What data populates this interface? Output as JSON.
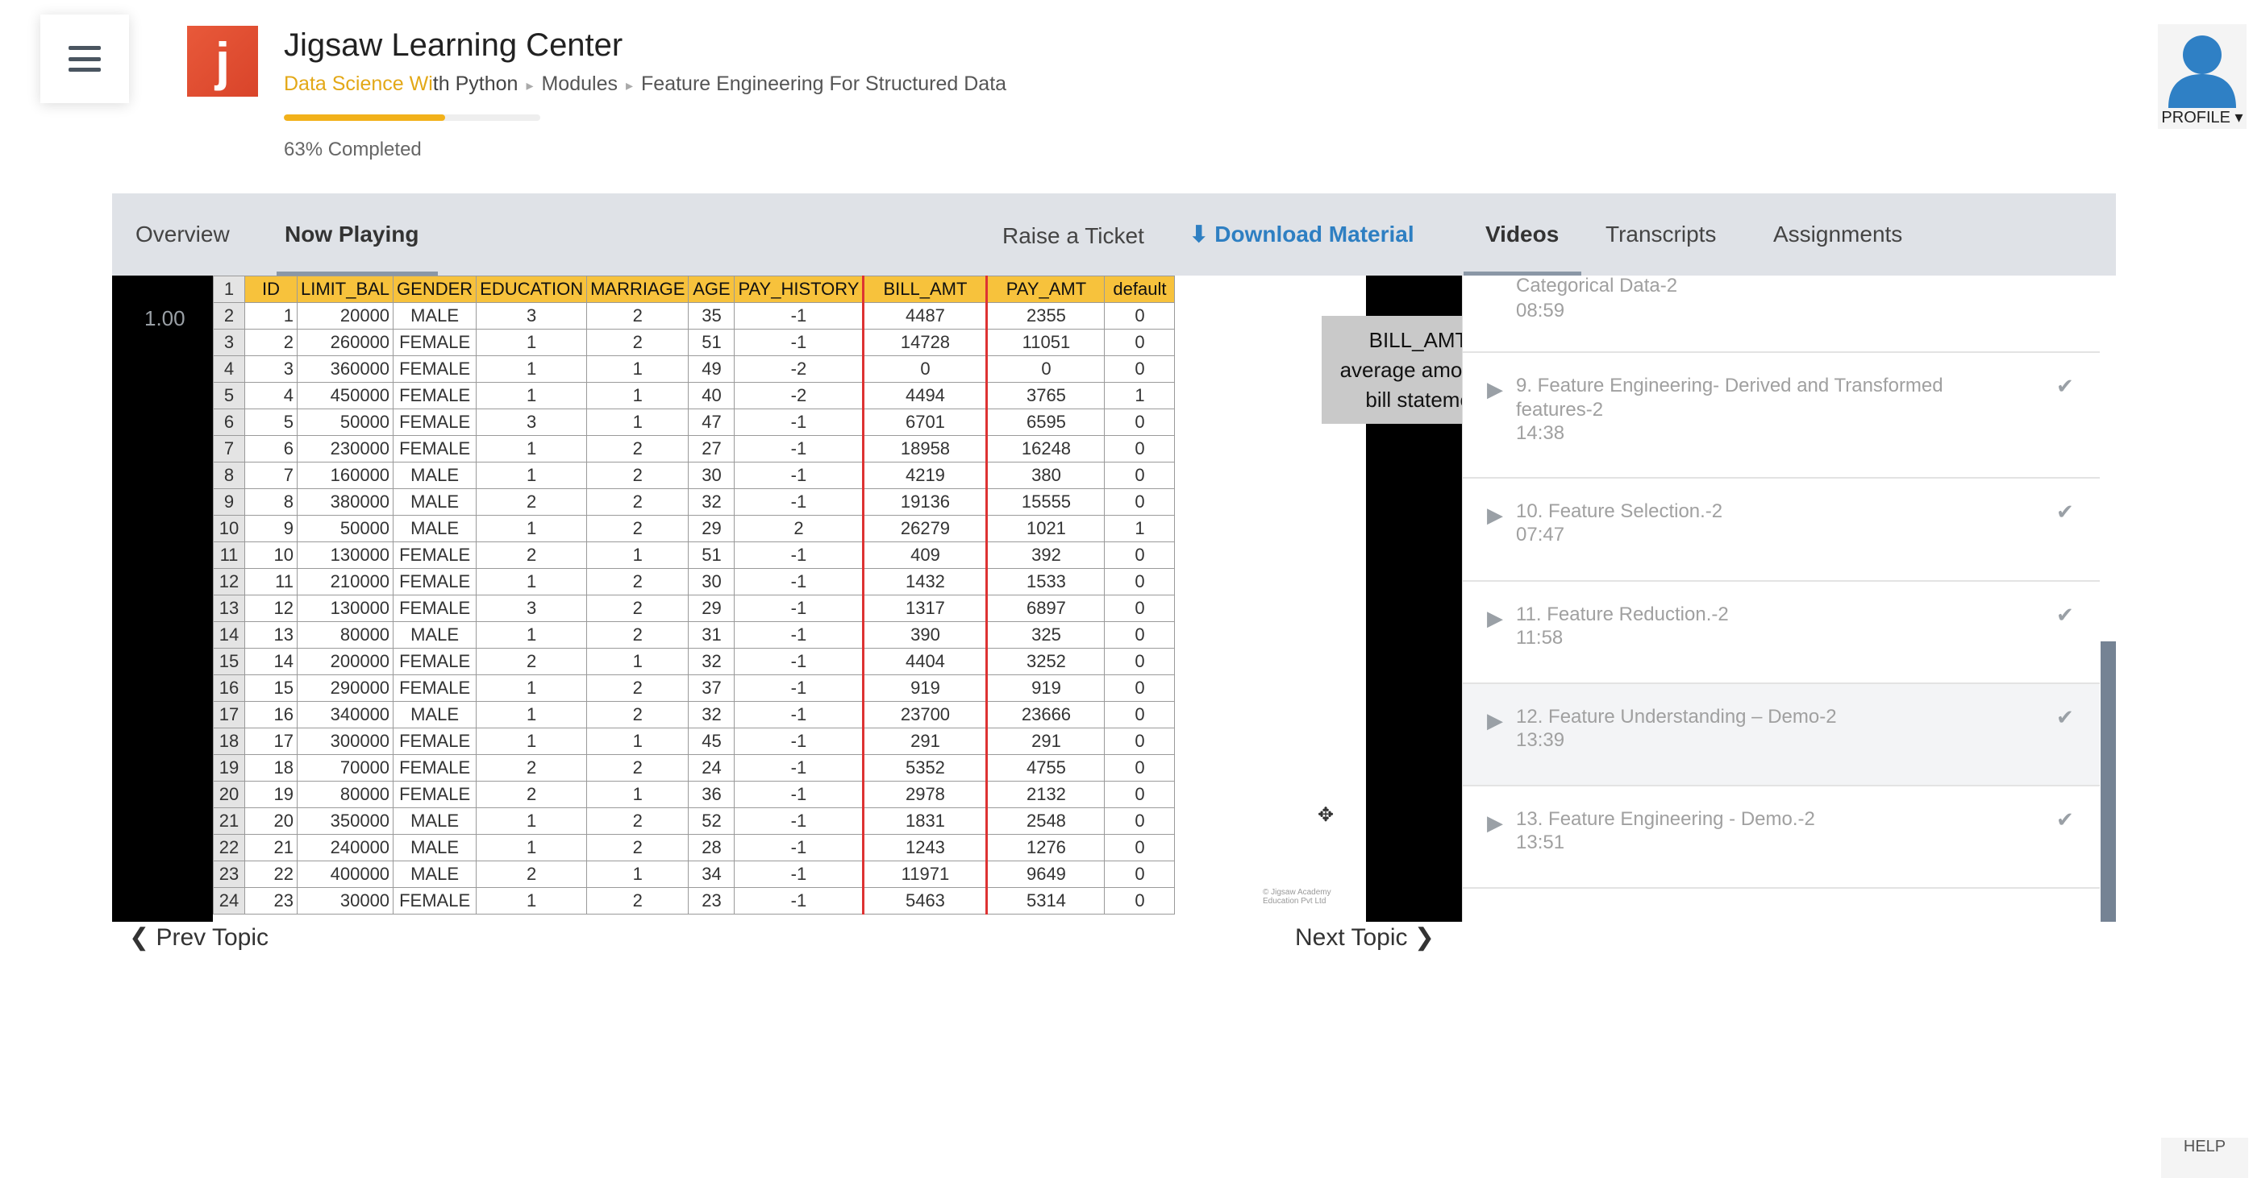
{
  "header": {
    "app_title": "Jigsaw Learning Center",
    "logo_letter": "j",
    "breadcrumb": {
      "course_highlight": "Data Science Wi",
      "course_rest": "th Python",
      "modules": "Modules",
      "topic": "Feature Engineering For Structured Data"
    },
    "progress_fraction": 0.63,
    "progress_text": "63% Completed",
    "profile_label": "PROFILE ▾"
  },
  "tabs": {
    "overview": "Overview",
    "now_playing": "Now Playing",
    "raise_ticket": "Raise a Ticket",
    "download_material": "Download Material",
    "videos": "Videos",
    "transcripts": "Transcripts",
    "assignments": "Assignments"
  },
  "video": {
    "speed": "1.00",
    "note": "BILL_AMT = average amount of bill statement",
    "credit": "© Jigsaw Academy Education Pvt Ltd",
    "sheet": {
      "columns": [
        "ID",
        "LIMIT_BAL",
        "GENDER",
        "EDUCATION",
        "MARRIAGE",
        "AGE",
        "PAY_HISTORY",
        "BILL_AMT",
        "PAY_AMT",
        "default"
      ],
      "rows": [
        [
          "1",
          "20000",
          "MALE",
          "3",
          "2",
          "35",
          "-1",
          "4487",
          "2355",
          "0"
        ],
        [
          "2",
          "260000",
          "FEMALE",
          "1",
          "2",
          "51",
          "-1",
          "14728",
          "11051",
          "0"
        ],
        [
          "3",
          "360000",
          "FEMALE",
          "1",
          "1",
          "49",
          "-2",
          "0",
          "0",
          "0"
        ],
        [
          "4",
          "450000",
          "FEMALE",
          "1",
          "1",
          "40",
          "-2",
          "4494",
          "3765",
          "1"
        ],
        [
          "5",
          "50000",
          "FEMALE",
          "3",
          "1",
          "47",
          "-1",
          "6701",
          "6595",
          "0"
        ],
        [
          "6",
          "230000",
          "FEMALE",
          "1",
          "2",
          "27",
          "-1",
          "18958",
          "16248",
          "0"
        ],
        [
          "7",
          "160000",
          "MALE",
          "1",
          "2",
          "30",
          "-1",
          "4219",
          "380",
          "0"
        ],
        [
          "8",
          "380000",
          "MALE",
          "2",
          "2",
          "32",
          "-1",
          "19136",
          "15555",
          "0"
        ],
        [
          "9",
          "50000",
          "MALE",
          "1",
          "2",
          "29",
          "2",
          "26279",
          "1021",
          "1"
        ],
        [
          "10",
          "130000",
          "FEMALE",
          "2",
          "1",
          "51",
          "-1",
          "409",
          "392",
          "0"
        ],
        [
          "11",
          "210000",
          "FEMALE",
          "1",
          "2",
          "30",
          "-1",
          "1432",
          "1533",
          "0"
        ],
        [
          "12",
          "130000",
          "FEMALE",
          "3",
          "2",
          "29",
          "-1",
          "1317",
          "6897",
          "0"
        ],
        [
          "13",
          "80000",
          "MALE",
          "1",
          "2",
          "31",
          "-1",
          "390",
          "325",
          "0"
        ],
        [
          "14",
          "200000",
          "FEMALE",
          "2",
          "1",
          "32",
          "-1",
          "4404",
          "3252",
          "0"
        ],
        [
          "15",
          "290000",
          "FEMALE",
          "1",
          "2",
          "37",
          "-1",
          "919",
          "919",
          "0"
        ],
        [
          "16",
          "340000",
          "MALE",
          "1",
          "2",
          "32",
          "-1",
          "23700",
          "23666",
          "0"
        ],
        [
          "17",
          "300000",
          "FEMALE",
          "1",
          "1",
          "45",
          "-1",
          "291",
          "291",
          "0"
        ],
        [
          "18",
          "70000",
          "FEMALE",
          "2",
          "2",
          "24",
          "-1",
          "5352",
          "4755",
          "0"
        ],
        [
          "19",
          "80000",
          "FEMALE",
          "2",
          "1",
          "36",
          "-1",
          "2978",
          "2132",
          "0"
        ],
        [
          "20",
          "350000",
          "MALE",
          "1",
          "2",
          "52",
          "-1",
          "1831",
          "2548",
          "0"
        ],
        [
          "21",
          "240000",
          "MALE",
          "1",
          "2",
          "28",
          "-1",
          "1243",
          "1276",
          "0"
        ],
        [
          "22",
          "400000",
          "MALE",
          "2",
          "1",
          "34",
          "-1",
          "11971",
          "9649",
          "0"
        ],
        [
          "23",
          "30000",
          "FEMALE",
          "1",
          "2",
          "23",
          "-1",
          "5463",
          "5314",
          "0"
        ]
      ]
    }
  },
  "playlist": [
    {
      "title": "Categorical Data-2",
      "duration": "08:59",
      "completed": false
    },
    {
      "title": "9. Feature Engineering- Derived and Transformed features-2",
      "duration": "14:38",
      "completed": true
    },
    {
      "title": "10. Feature Selection.-2",
      "duration": "07:47",
      "completed": true
    },
    {
      "title": "11. Feature Reduction.-2",
      "duration": "11:58",
      "completed": true
    },
    {
      "title": "12. Feature Understanding – Demo-2",
      "duration": "13:39",
      "completed": true
    },
    {
      "title": "13. Feature Engineering - Demo.-2",
      "duration": "13:51",
      "completed": true
    }
  ],
  "nav": {
    "prev": "Prev Topic",
    "next": "Next Topic"
  },
  "help_label": "HELP"
}
